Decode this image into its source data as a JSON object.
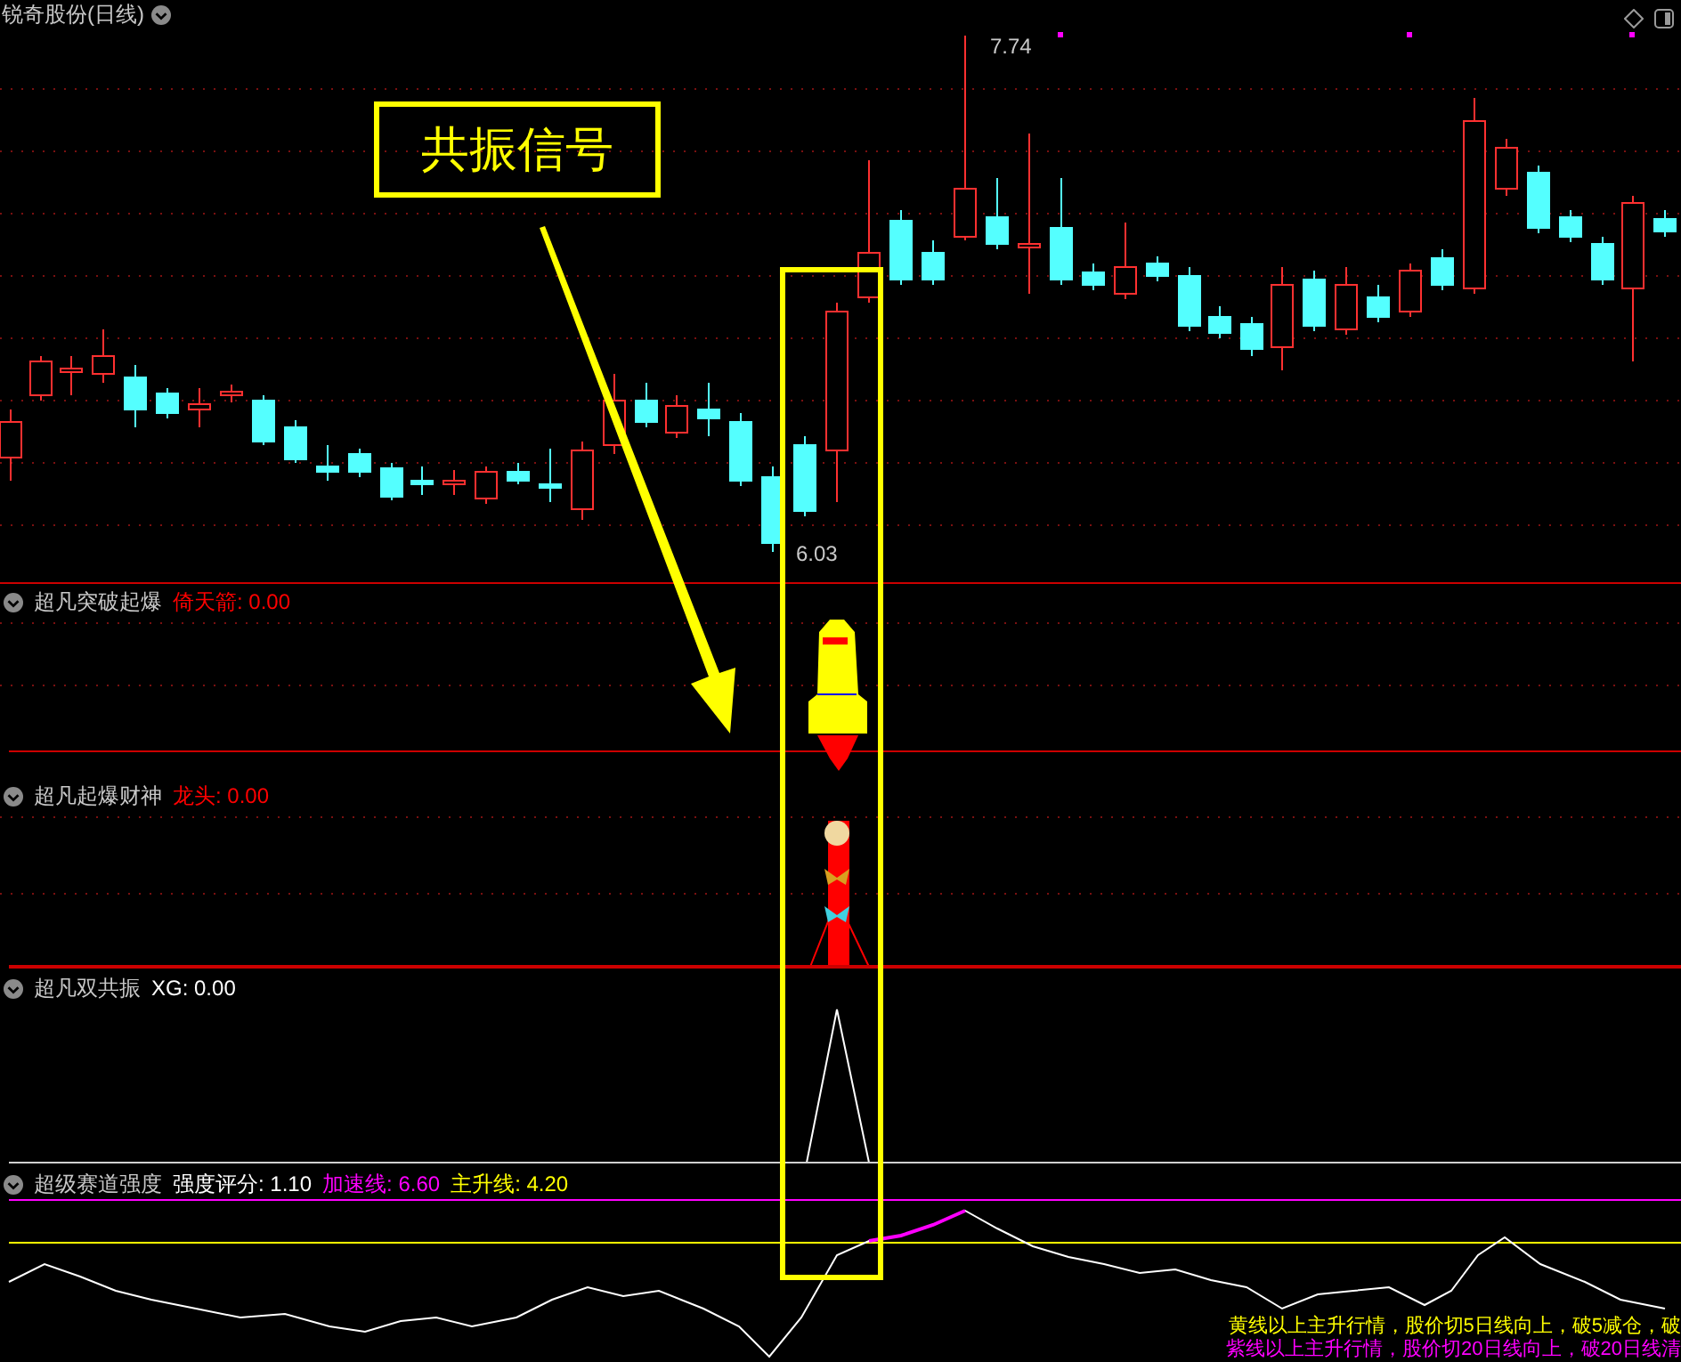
{
  "window": {
    "title": "锐奇股份(日线)"
  },
  "main_chart": {
    "high_label": "7.74",
    "low_label": "6.03"
  },
  "annotation": {
    "text": "共振信号"
  },
  "panels": [
    {
      "kind": "rocket",
      "name": "超凡突破起爆",
      "readings": [
        {
          "label": "倚天箭: 0.00",
          "color": "#ff0000"
        }
      ]
    },
    {
      "kind": "fortune",
      "name": "超凡起爆财神",
      "readings": [
        {
          "label": "龙头: 0.00",
          "color": "#ff0000"
        }
      ]
    },
    {
      "kind": "peak",
      "name": "超凡双共振",
      "readings": [
        {
          "label": "XG: 0.00",
          "color": "#ffffff"
        }
      ]
    },
    {
      "kind": "strength",
      "name": "超级赛道强度",
      "readings": [
        {
          "label": "强度评分: 1.10",
          "color": "#ffffff"
        },
        {
          "label": "加速线: 6.60",
          "color": "#ff00ff"
        },
        {
          "label": "主升线: 4.20",
          "color": "#ffff00"
        }
      ],
      "notes": [
        {
          "text": "黄线以上主升行情，股价切5日线向上，破5减仓，破",
          "color": "#ffff00"
        },
        {
          "text": "紫线以上主升行情，股价切20日线向上，破20日线清",
          "color": "#ff00ff"
        }
      ]
    }
  ]
}
